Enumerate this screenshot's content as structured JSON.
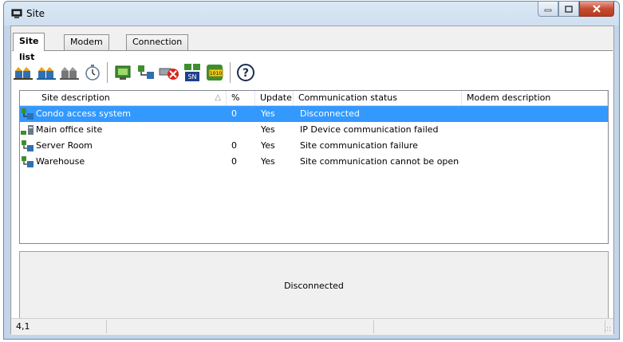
{
  "window": {
    "title": "Site",
    "title_icon": "site-monitor-icon",
    "caption_buttons": [
      "minimize-icon",
      "maximize-icon",
      "close-icon"
    ]
  },
  "tabs": [
    {
      "label": "Site list",
      "active": true
    },
    {
      "label": "Modem list",
      "active": false
    },
    {
      "label": "Connection and wait Lists",
      "active": false
    }
  ],
  "toolbar": {
    "icons": [
      "connect-site-icon",
      "connect-all-sites-icon",
      "disconnect-site-icon",
      "clock-icon",
      "site-ip-icon",
      "network-site-icon",
      "stop-communication-icon",
      "serial-number-icon",
      "binary-data-icon",
      "help-icon"
    ]
  },
  "site_list": {
    "columns": [
      "Site description",
      "%",
      "Update",
      "Communication status",
      "Modem description"
    ],
    "sort_indicator": "△",
    "rows": [
      {
        "description": "Condo access system",
        "percent": "0",
        "update": "Yes",
        "status": "Disconnected",
        "modem": "",
        "selected": true,
        "icon": "site-network-icon"
      },
      {
        "description": "Main office site",
        "percent": "",
        "update": "Yes",
        "status": "IP Device communication failed",
        "modem": "",
        "selected": false,
        "icon": "site-ip-device-icon"
      },
      {
        "description": "Server Room",
        "percent": "0",
        "update": "Yes",
        "status": "Site communication failure",
        "modem": "",
        "selected": false,
        "icon": "site-network-icon"
      },
      {
        "description": "Warehouse",
        "percent": "0",
        "update": "Yes",
        "status": "Site communication cannot be opened",
        "modem": "",
        "selected": false,
        "icon": "site-network-icon"
      }
    ]
  },
  "status_pane": {
    "message": "Disconnected"
  },
  "statusbar": {
    "position": "4,1",
    "cell2": "",
    "cell3": ""
  },
  "colors": {
    "selection": "#3399ff",
    "close_button": "#c44c31"
  }
}
